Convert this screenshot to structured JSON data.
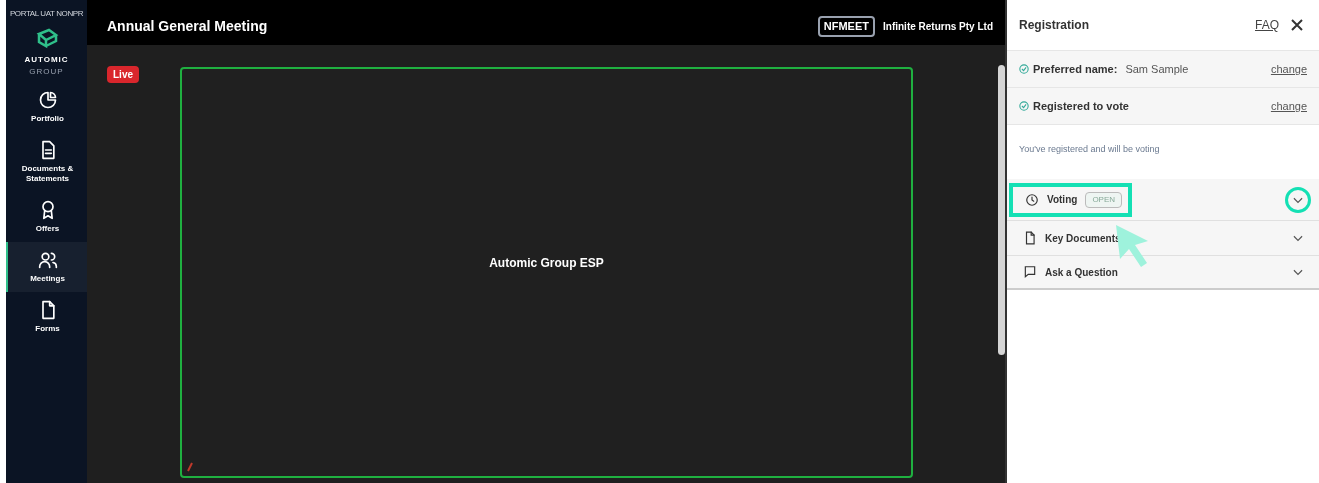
{
  "sidebar": {
    "env_label": "PORTAL UAT NONPR",
    "logo": {
      "line1": "AUTOMIC",
      "line2": "GROUP"
    },
    "items": [
      {
        "kind": "portfolio",
        "label": "Portfolio",
        "selected": false
      },
      {
        "kind": "documents",
        "label": "Documents & Statements",
        "selected": false
      },
      {
        "kind": "offers",
        "label": "Offers",
        "selected": false
      },
      {
        "kind": "meetings",
        "label": "Meetings",
        "selected": true
      },
      {
        "kind": "forms",
        "label": "Forms",
        "selected": false
      }
    ]
  },
  "header": {
    "title": "Annual General Meeting",
    "code": "NFMEET",
    "company": "Infinite Returns Pty Ltd"
  },
  "stage": {
    "live_badge": "Live",
    "presenter": "Automic Group ESP"
  },
  "panel": {
    "title": "Registration",
    "faq": "FAQ",
    "rows": [
      {
        "label": "Preferred name:",
        "value": "Sam Sample",
        "link": "change"
      },
      {
        "label": "Registered to vote",
        "link": "change"
      }
    ],
    "note": "You've registered and will be voting",
    "sections": [
      {
        "kind": "clock",
        "label": "Voting",
        "badge": "OPEN",
        "highlighted": true
      },
      {
        "kind": "document",
        "label": "Key Documents",
        "highlighted": false
      },
      {
        "kind": "chat",
        "label": "Ask a Question",
        "highlighted": false
      }
    ]
  }
}
